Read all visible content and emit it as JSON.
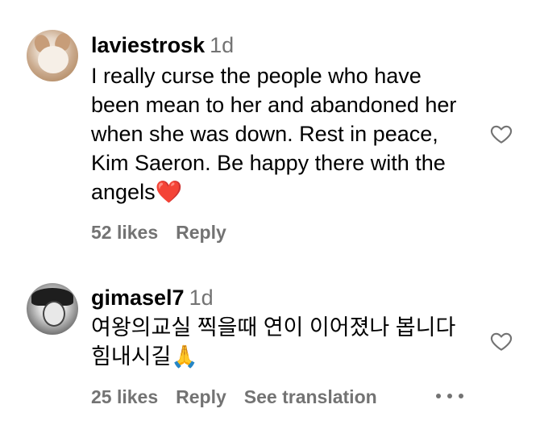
{
  "comments": [
    {
      "username": "laviestrosk",
      "time": "1d",
      "text": "I really curse the people who have been mean to her and abandoned her when she was down. Rest in peace, Kim Saeron. Be happy there with the angels❤️",
      "likes": "52 likes",
      "reply": "Reply",
      "avatar_icon": "hamster-avatar"
    },
    {
      "username": "gimasel7",
      "time": "1d",
      "text": "여왕의교실 찍을때 연이 이어졌나 봅니다 힘내시길🙏",
      "likes": "25 likes",
      "reply": "Reply",
      "see_translation": "See translation",
      "avatar_icon": "sketch-avatar"
    }
  ],
  "icons": {
    "like": "heart-outline-icon",
    "more": "more-options-icon"
  },
  "colors": {
    "secondary_text": "#737373",
    "heart_outline": "#737373",
    "primary_text": "#000000",
    "background": "#ffffff"
  }
}
